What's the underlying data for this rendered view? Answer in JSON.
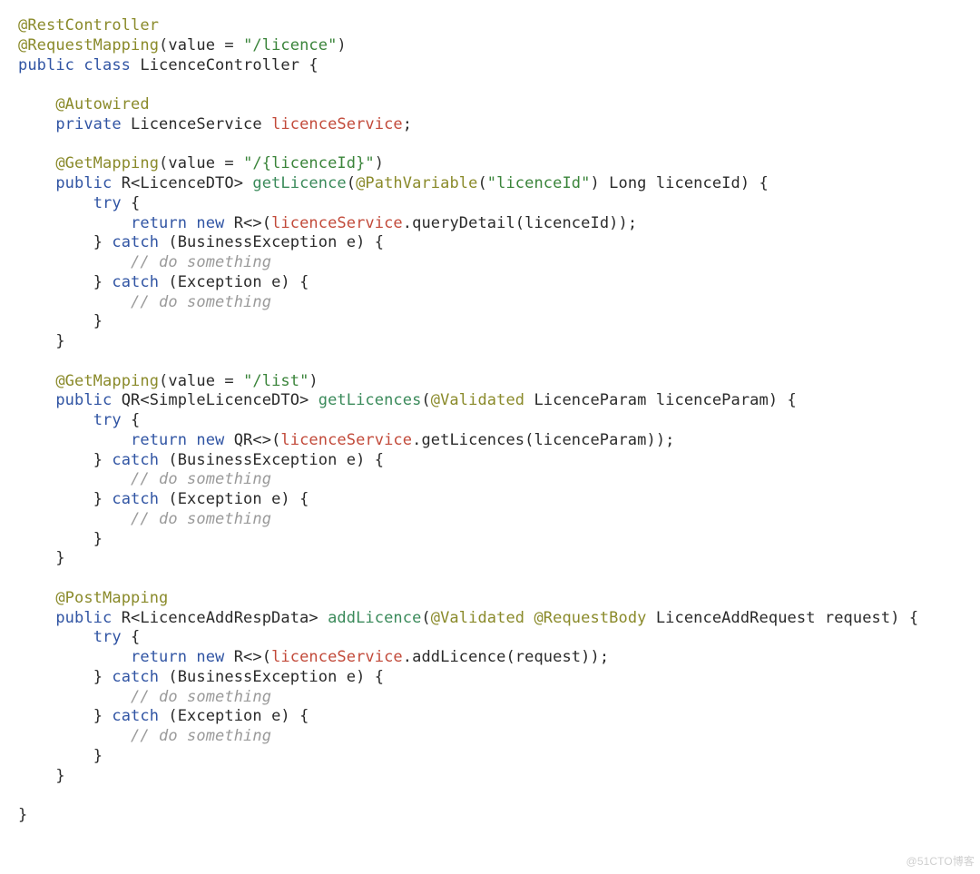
{
  "watermark": "@51CTO博客",
  "code": {
    "class": {
      "ann1": "@RestController",
      "ann2": "@RequestMapping",
      "ann2_arg_key": "value = ",
      "ann2_arg_val": "\"/licence\"",
      "decl_pre": "public class",
      "decl_name": " LicenceController {"
    },
    "field": {
      "ann": "@Autowired",
      "mod": "private",
      "type": " LicenceService ",
      "name": "licenceService",
      "end": ";"
    },
    "m1": {
      "ann": "@GetMapping",
      "ann_arg_key": "value = ",
      "ann_arg_val": "\"/{licenceId}\"",
      "sig_pre": "public",
      "sig_ret": " R<LicenceDTO> ",
      "sig_name": "getLicence",
      "sig_open": "(",
      "sig_ann": "@PathVariable",
      "sig_ann_open": "(",
      "sig_ann_arg": "\"licenceId\"",
      "sig_ann_close": ")",
      "sig_rest": " Long licenceId) {",
      "try": "try",
      "try_open": " {",
      "ret_kw": "return new",
      "ret_expr_pre": " R<>(",
      "ret_fld": "licenceService",
      "ret_call": ".queryDetail(licenceId));",
      "catch1_kw": "catch",
      "catch1_args": " (BusinessException e) {",
      "cmt": "// do something",
      "catch2_kw": "catch",
      "catch2_args": " (Exception e) {"
    },
    "m2": {
      "ann": "@GetMapping",
      "ann_arg_key": "value = ",
      "ann_arg_val": "\"/list\"",
      "sig_pre": "public",
      "sig_ret": " QR<SimpleLicenceDTO> ",
      "sig_name": "getLicences",
      "sig_open": "(",
      "sig_ann": "@Validated",
      "sig_rest": " LicenceParam licenceParam) {",
      "ret_expr_pre": " QR<>(",
      "ret_call": ".getLicences(licenceParam));"
    },
    "m3": {
      "ann": "@PostMapping",
      "sig_pre": "public",
      "sig_ret": " R<LicenceAddRespData> ",
      "sig_name": "addLicence",
      "sig_open": "(",
      "sig_ann1": "@Validated",
      "sig_sp": " ",
      "sig_ann2": "@RequestBody",
      "sig_rest": " LicenceAddRequest request) {",
      "ret_expr_pre": " R<>(",
      "ret_call": ".addLicence(request));"
    },
    "braces": {
      "close": "}",
      "close_catch_open": "} "
    }
  }
}
